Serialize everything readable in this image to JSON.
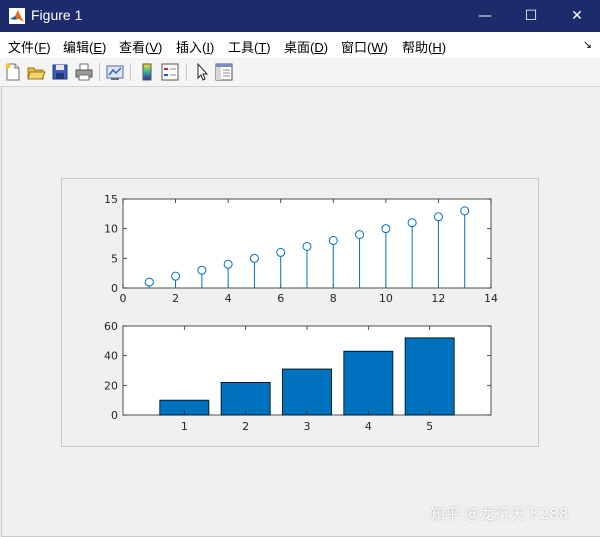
{
  "window": {
    "title": "Figure 1",
    "minimize_glyph": "—",
    "maximize_glyph": "☐",
    "close_glyph": "✕"
  },
  "menubar": {
    "items": [
      {
        "label": "文件(",
        "key": "F",
        "suffix": ")"
      },
      {
        "label": "编辑(",
        "key": "E",
        "suffix": ")"
      },
      {
        "label": "查看(",
        "key": "V",
        "suffix": ")"
      },
      {
        "label": "插入(",
        "key": "I",
        "suffix": ")"
      },
      {
        "label": "工具(",
        "key": "T",
        "suffix": ")"
      },
      {
        "label": "桌面(",
        "key": "D",
        "suffix": ")"
      },
      {
        "label": "窗口(",
        "key": "W",
        "suffix": ")"
      },
      {
        "label": "帮助(",
        "key": "H",
        "suffix": ")"
      }
    ],
    "dock_glyph": "↘"
  },
  "toolbar": {
    "icons": [
      "new-figure-icon",
      "open-file-icon",
      "save-icon",
      "print-icon",
      "link-plot-icon",
      "colorbar-icon",
      "legend-icon",
      "pointer-icon",
      "property-inspector-icon"
    ]
  },
  "watermark": "知乎 @龙行天下288",
  "colors": {
    "stem": "#0072bd",
    "bar": "#0072bd",
    "titlebar": "#1b2b6b"
  },
  "chart_data": [
    {
      "type": "scatter",
      "style": "stem",
      "marker": "circle",
      "x": [
        1,
        2,
        3,
        4,
        5,
        6,
        7,
        8,
        9,
        10,
        11,
        12,
        13
      ],
      "y": [
        1,
        2,
        3,
        4,
        5,
        6,
        7,
        8,
        9,
        10,
        11,
        12,
        13
      ],
      "xlim": [
        0,
        14
      ],
      "ylim": [
        0,
        15
      ],
      "xticks": [
        0,
        2,
        4,
        6,
        8,
        10,
        12,
        14
      ],
      "yticks": [
        0,
        5,
        10,
        15
      ],
      "grid": false
    },
    {
      "type": "bar",
      "categories": [
        "1",
        "2",
        "3",
        "4",
        "5"
      ],
      "values": [
        10,
        22,
        31,
        43,
        52
      ],
      "xlim": [
        0,
        6
      ],
      "ylim": [
        0,
        60
      ],
      "yticks": [
        0,
        20,
        40,
        60
      ],
      "grid": false
    }
  ]
}
